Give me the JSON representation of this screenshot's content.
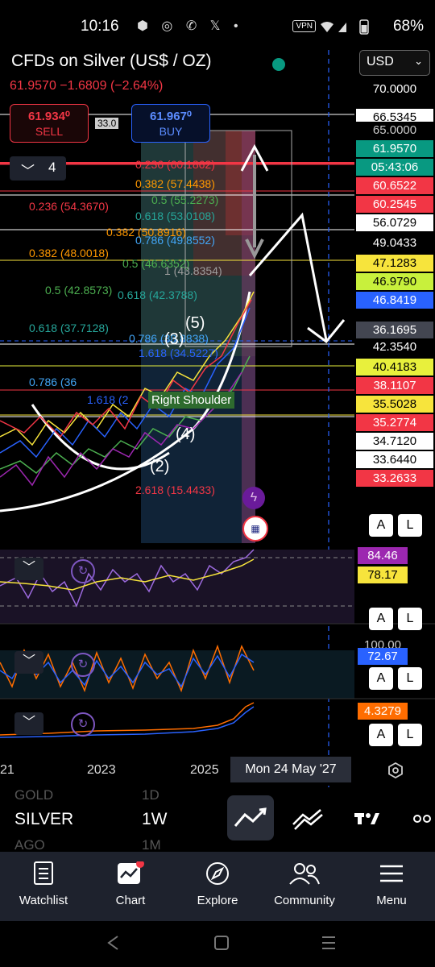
{
  "status_bar": {
    "time": "10:16",
    "notification_icons": "⬢ ◎ ✆ 𝕏 •",
    "vpn": "VPN",
    "battery": "68%"
  },
  "chart": {
    "title": "CFDs on Silver (US$ / OZ)",
    "quote": "61.9570 −1.6809 (−2.64%)",
    "sell": {
      "price": "61.934⁰",
      "label": "SELL"
    },
    "buy": {
      "price": "61.967⁰",
      "label": "BUY"
    },
    "spread": "33.0",
    "collapse_count": "4",
    "currency": "USD",
    "price_labels": [
      {
        "text": "70.0000",
        "bg": "#000000",
        "fg": "#ffffff"
      },
      {
        "text": "66.5345",
        "bg": "#ffffff",
        "fg": "#000000"
      },
      {
        "text": "65.0000",
        "bg": "#000000",
        "fg": "#cccccc"
      },
      {
        "text": "61.9570",
        "bg": "#089981",
        "fg": "#ffffff"
      },
      {
        "text": "05:43:06",
        "bg": "#089981",
        "fg": "#ffffff"
      },
      {
        "text": "60.6522",
        "bg": "#f23645",
        "fg": "#ffffff"
      },
      {
        "text": "60.2545",
        "bg": "#f23645",
        "fg": "#ffffff"
      },
      {
        "text": "56.0729",
        "bg": "#ffffff",
        "fg": "#000000"
      },
      {
        "text": "49.0433",
        "bg": "#000000",
        "fg": "#ffffff"
      },
      {
        "text": "47.1283",
        "bg": "#f7e43c",
        "fg": "#000000"
      },
      {
        "text": "46.9790",
        "bg": "#c8f03c",
        "fg": "#000000"
      },
      {
        "text": "46.8419",
        "bg": "#2962ff",
        "fg": "#ffffff"
      },
      {
        "text": "36.1695",
        "bg": "#434651",
        "fg": "#ffffff"
      },
      {
        "text": "42.3540",
        "bg": "#000000",
        "fg": "#ffffff"
      },
      {
        "text": "40.4183",
        "bg": "#e8f03c",
        "fg": "#000000"
      },
      {
        "text": "38.1107",
        "bg": "#f23645",
        "fg": "#ffffff"
      },
      {
        "text": "35.5028",
        "bg": "#f7e43c",
        "fg": "#000000"
      },
      {
        "text": "35.2774",
        "bg": "#f23645",
        "fg": "#ffffff"
      },
      {
        "text": "34.7120",
        "bg": "#ffffff",
        "fg": "#000000"
      },
      {
        "text": "33.6440",
        "bg": "#ffffff",
        "fg": "#000000"
      },
      {
        "text": "33.2633",
        "bg": "#f23645",
        "fg": "#ffffff"
      }
    ],
    "fib_labels": [
      {
        "text": "0.236 (60.1862)",
        "color": "#f23645"
      },
      {
        "text": "0.382 (57.4438)",
        "color": "#ff9800"
      },
      {
        "text": "0.5 (55.2273)",
        "color": "#4caf50"
      },
      {
        "text": "0.236 (54.3670)",
        "color": "#f23645"
      },
      {
        "text": "0.618 (53.0108)",
        "color": "#26a69a"
      },
      {
        "text": "0.382 (50.8916)",
        "color": "#ff9800"
      },
      {
        "text": "0.786 (49.8552)",
        "color": "#42a5f5"
      },
      {
        "text": "0.382 (48.0018)",
        "color": "#ff9800"
      },
      {
        "text": "0.5 (46.6352)",
        "color": "#4caf50"
      },
      {
        "text": "1 (43.8354)",
        "color": "#9e9e9e"
      },
      {
        "text": "0.5 (42.8573)",
        "color": "#4caf50"
      },
      {
        "text": "0.618 (42.3788)",
        "color": "#26a69a"
      },
      {
        "text": "0.618 (37.7128)",
        "color": "#26a69a"
      },
      {
        "text": "0.786 (38.8838)",
        "color": "#42a5f5"
      },
      {
        "text": "1.618 (34.5227)",
        "color": "#2962ff"
      },
      {
        "text": "0.786 (36",
        "color": "#42a5f5"
      },
      {
        "text": "1.618 (2",
        "color": "#2962ff"
      },
      {
        "text": "2.618 (15.4433)",
        "color": "#f23645"
      }
    ],
    "wave_labels": [
      "(5)",
      "(3)",
      "(4)",
      "(2)"
    ],
    "pattern_label": "Right Shoulder",
    "indicators": [
      {
        "values": [
          "84.46",
          "78.17"
        ],
        "colors": [
          "#9c27b0",
          "#f7e43c"
        ],
        "value_fg": [
          "#ffffff",
          "#000000"
        ]
      },
      {
        "values": [
          "100.00",
          "72.67"
        ],
        "colors": [
          "#000000",
          "#2962ff"
        ],
        "value_fg": [
          "#cccccc",
          "#ffffff"
        ]
      },
      {
        "values": [
          "4.3279"
        ],
        "colors": [
          "#ff6d00"
        ],
        "value_fg": [
          "#ffffff"
        ]
      }
    ],
    "al_a": "A",
    "al_l": "L",
    "x_labels": [
      "21",
      "2023",
      "2025"
    ],
    "crosshair_date": "Mon 24 May '27"
  },
  "ribbon": {
    "prev_symbol": "GOLD",
    "prev_tf": "1D",
    "symbol": "SILVER",
    "timeframe": "1W",
    "next_symbol": "AGO",
    "next_tf": "1M"
  },
  "nav": {
    "items": [
      {
        "label": "Watchlist",
        "icon": "watchlist-icon"
      },
      {
        "label": "Chart",
        "icon": "chart-icon"
      },
      {
        "label": "Explore",
        "icon": "compass-icon"
      },
      {
        "label": "Community",
        "icon": "community-icon"
      },
      {
        "label": "Menu",
        "icon": "menu-icon"
      }
    ]
  }
}
